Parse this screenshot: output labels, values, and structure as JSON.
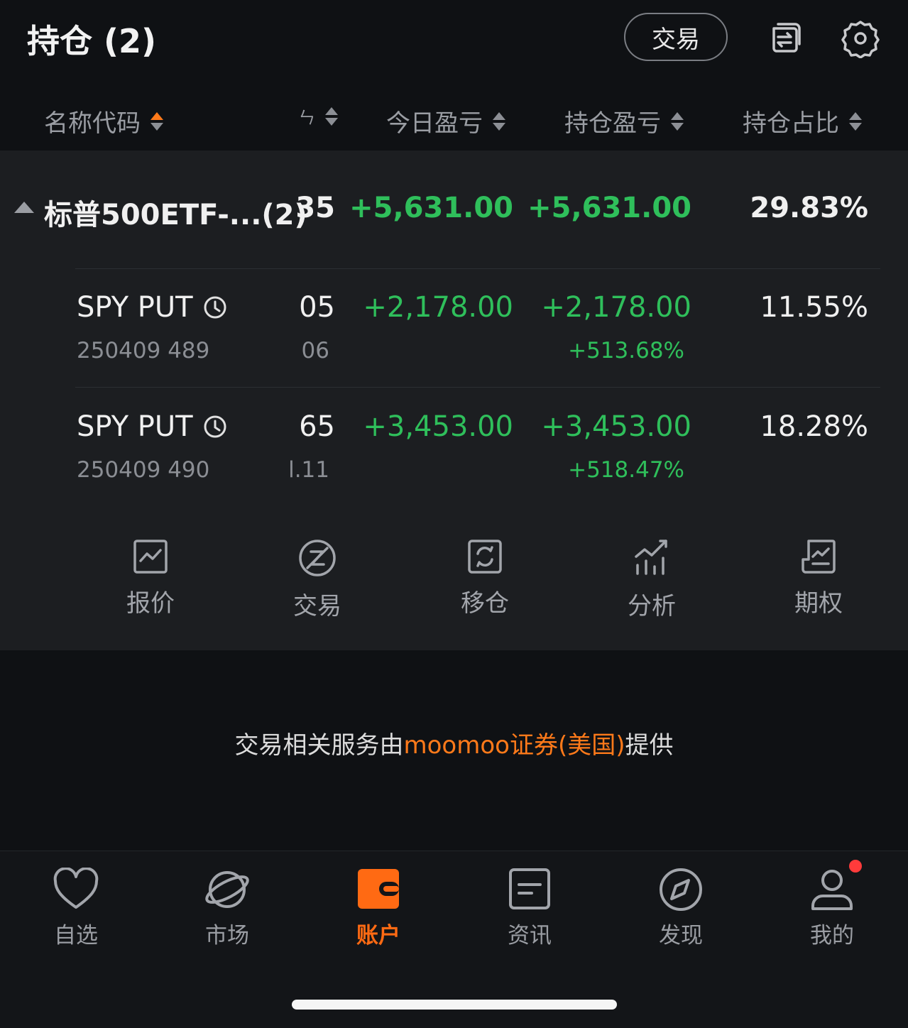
{
  "header": {
    "title": "持仓 (2)",
    "trade_button": "交易"
  },
  "columns": {
    "name": "名称代码",
    "qty_partial": "ㄣ",
    "today_pl": "今日盈亏",
    "position_pl": "持仓盈亏",
    "weight": "持仓占比"
  },
  "group": {
    "name": "标普500ETF-...",
    "count": "(2)",
    "qty": "35",
    "today_pl": "+5,631.00",
    "position_pl": "+5,631.00",
    "weight": "29.83%"
  },
  "rows": [
    {
      "symbol": "SPY PUT",
      "code": "250409 489",
      "qty": "05",
      "qty_sub": "06",
      "today_pl": "+2,178.00",
      "position_pl": "+2,178.00",
      "position_pl_pct": "+513.68%",
      "weight": "11.55%"
    },
    {
      "symbol": "SPY PUT",
      "code": "250409 490",
      "qty": "65",
      "qty_sub": "l.11",
      "today_pl": "+3,453.00",
      "position_pl": "+3,453.00",
      "position_pl_pct": "+518.47%",
      "weight": "18.28%"
    }
  ],
  "actions": [
    {
      "label": "报价",
      "icon": "chart-icon"
    },
    {
      "label": "交易",
      "icon": "trade-icon"
    },
    {
      "label": "移仓",
      "icon": "roll-icon"
    },
    {
      "label": "分析",
      "icon": "analysis-icon"
    },
    {
      "label": "期权",
      "icon": "options-icon"
    }
  ],
  "provider": {
    "prefix": "交易相关服务由",
    "brand": "moomoo证券(美国)",
    "suffix": "提供"
  },
  "nav": {
    "items": [
      {
        "label": "自选",
        "icon": "heart-icon"
      },
      {
        "label": "市场",
        "icon": "planet-icon"
      },
      {
        "label": "账户",
        "icon": "wallet-icon"
      },
      {
        "label": "资讯",
        "icon": "news-icon"
      },
      {
        "label": "发现",
        "icon": "compass-icon"
      },
      {
        "label": "我的",
        "icon": "user-icon"
      }
    ],
    "active": "账户"
  },
  "colors": {
    "accent": "#ff7a1a",
    "gain": "#2fbf5b",
    "background": "#0f1114",
    "panel": "#1c1e21"
  }
}
